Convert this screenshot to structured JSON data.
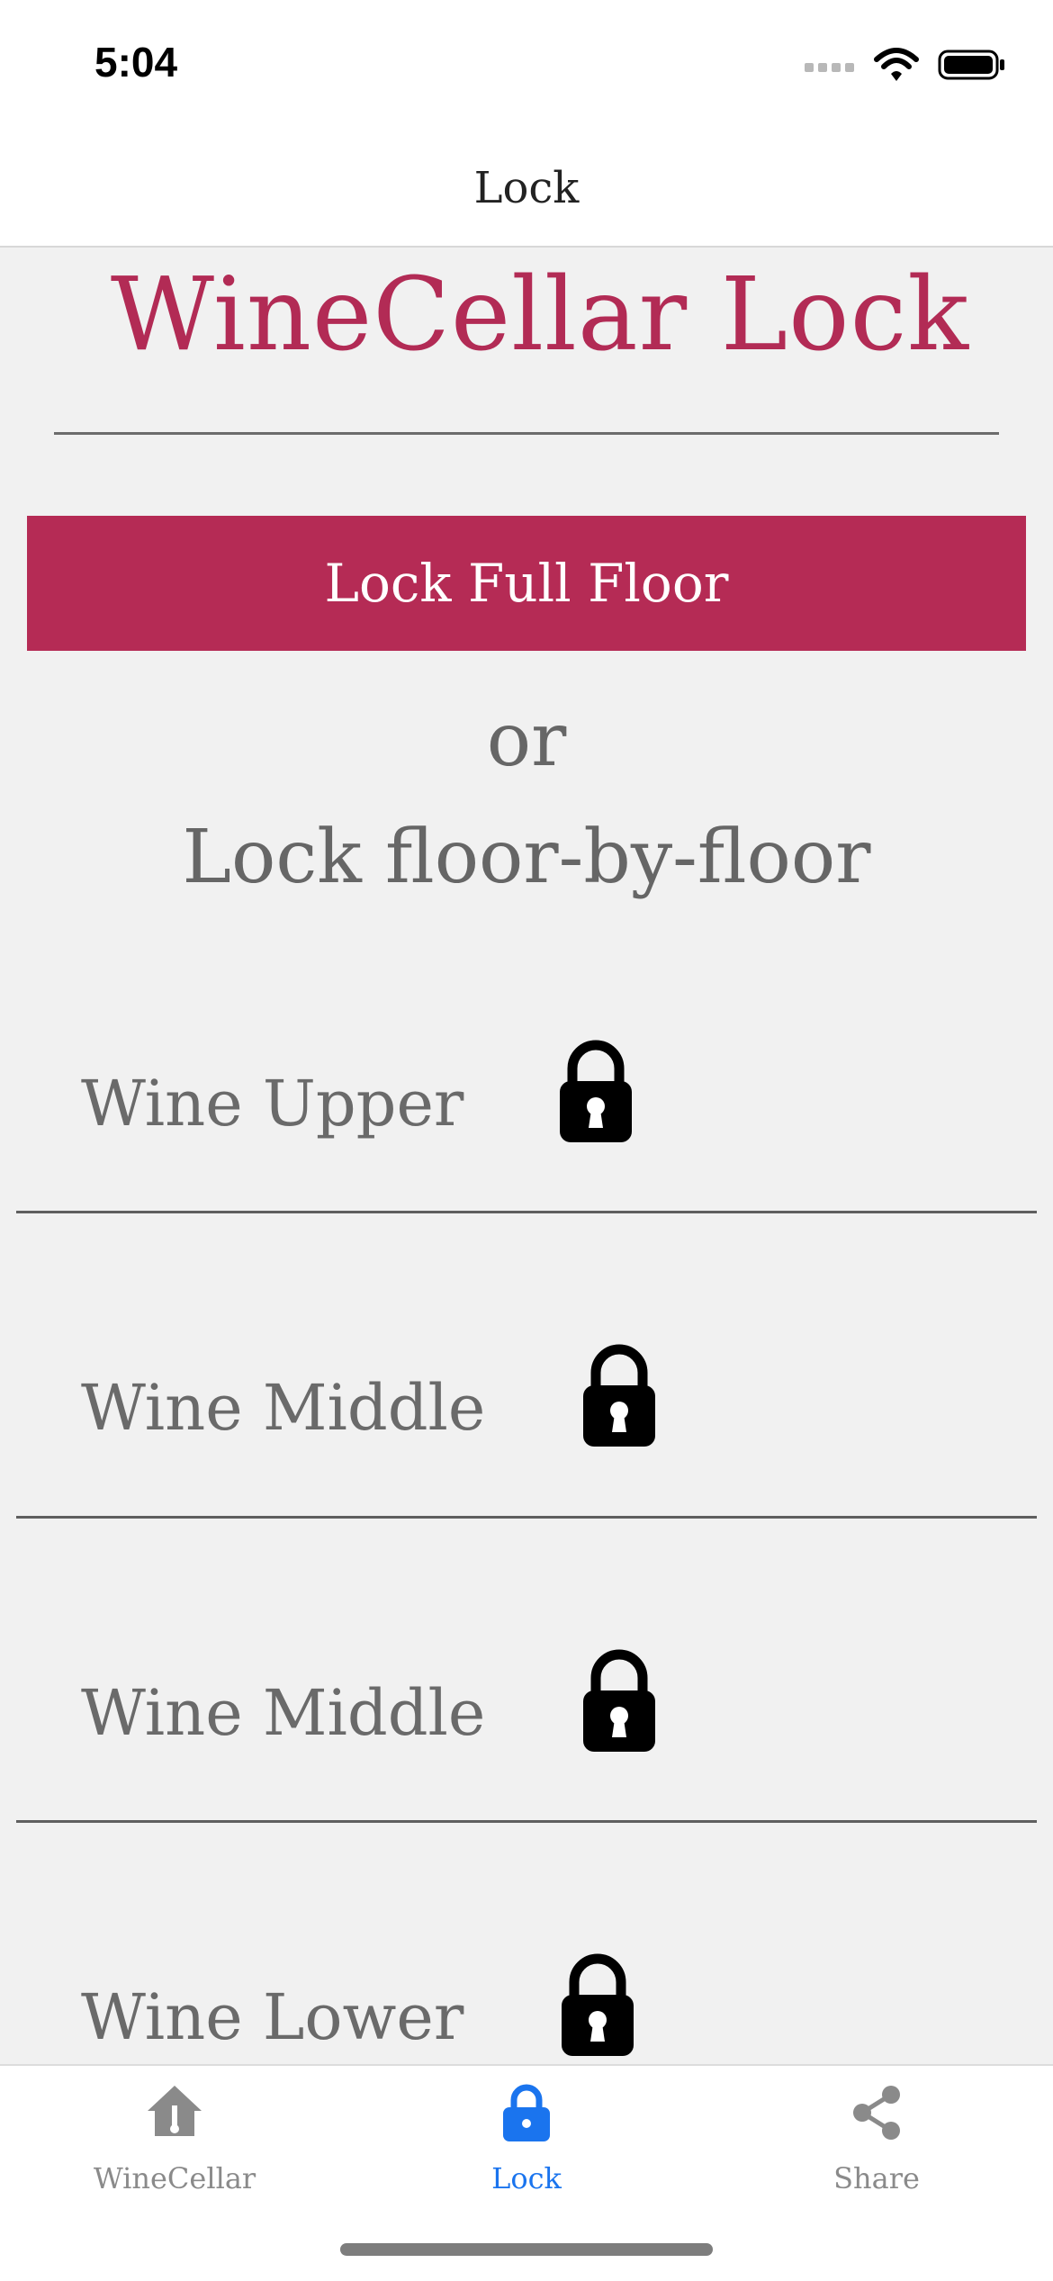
{
  "status_bar": {
    "time": "5:04"
  },
  "nav": {
    "title": "Lock"
  },
  "main": {
    "title": "WineCellar Lock",
    "lock_full_label": "Lock Full Floor",
    "or_text": "or",
    "subtitle": "Lock floor-by-floor",
    "floors": [
      {
        "label": "Wine Upper",
        "icon": "padlock-icon"
      },
      {
        "label": "Wine Middle",
        "icon": "padlock-icon"
      },
      {
        "label": "Wine Middle",
        "icon": "padlock-icon"
      },
      {
        "label": "Wine Lower",
        "icon": "padlock-icon"
      }
    ]
  },
  "tab_bar": {
    "tabs": [
      {
        "label": "WineCellar",
        "icon": "cellar-home-icon",
        "active": false
      },
      {
        "label": "Lock",
        "icon": "lock-icon",
        "active": true
      },
      {
        "label": "Share",
        "icon": "share-icon",
        "active": false
      }
    ]
  },
  "colors": {
    "brand": "#b52b55",
    "tab_active": "#1a74ee",
    "tab_inactive": "#8a8a8a"
  }
}
